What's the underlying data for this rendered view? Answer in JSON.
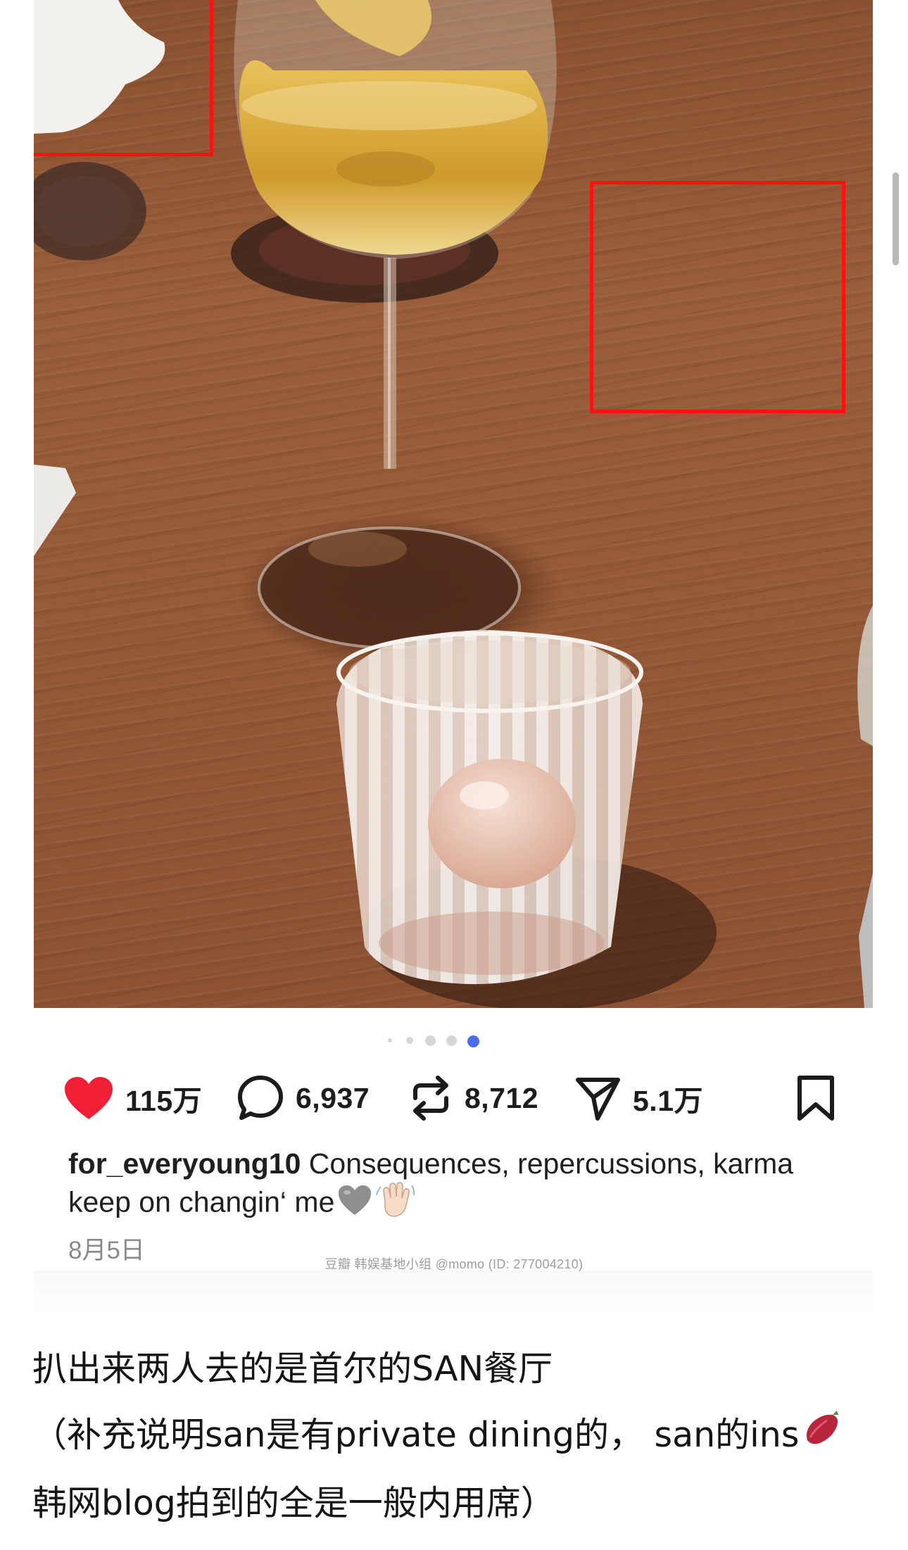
{
  "post": {
    "carousel": {
      "count": 5,
      "active_index": 4
    },
    "actions": {
      "likes": "115万",
      "comments": "6,937",
      "reposts": "8,712",
      "shares": "5.1万"
    },
    "caption": {
      "username": "for_everyoung10",
      "text": " Consequences, repercussions, karma keep on changin‘ me"
    },
    "date": "8月5日",
    "colors": {
      "like": "#f01f35",
      "active_dot": "#4a6cf0",
      "highlight_box": "#ff1010"
    }
  },
  "watermark": "豆瓣 韩娱基地小组 @momo (ID: 277004210)",
  "article": {
    "line1": "扒出来两人去的是首尔的SAN餐厅",
    "line2": "（补充说明san是有private dining的， san的ins",
    "line3": "韩网blog拍到的全是一般内用席）"
  },
  "icons": [
    "heart-icon",
    "comment-icon",
    "repost-icon",
    "send-icon",
    "bookmark-icon",
    "grey-heart-icon",
    "waving-hand-icon",
    "sweet-potato-icon"
  ]
}
